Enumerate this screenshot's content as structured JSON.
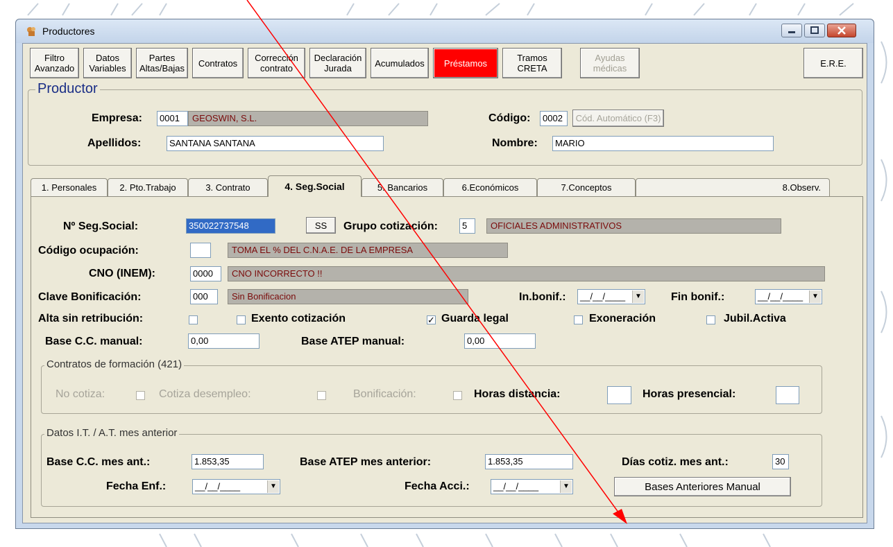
{
  "window": {
    "title": "Productores"
  },
  "toolbar": [
    {
      "label": "Filtro\nAvanzado"
    },
    {
      "label": "Datos\nVariables"
    },
    {
      "label": "Partes\nAltas/Bajas"
    },
    {
      "label": "Contratos"
    },
    {
      "label": "Corrección\ncontrato"
    },
    {
      "label": "Declaración\nJurada"
    },
    {
      "label": "Acumulados"
    },
    {
      "label": "Préstamos",
      "state": "highlighted",
      "color": "#ff0000"
    },
    {
      "label": "Tramos\nCRETA"
    },
    {
      "label": "Ayudas\nmédicas",
      "state": "disabled"
    },
    {
      "label": "E.R.E."
    }
  ],
  "productor": {
    "legend": "Productor",
    "empresa_label": "Empresa:",
    "empresa_code": "0001",
    "empresa_name": "GEOSWIN, S.L.",
    "codigo_label": "Código:",
    "codigo_value": "0002",
    "auto_button": "Cód. Automático (F3)",
    "apellidos_label": "Apellidos:",
    "apellidos_value": "SANTANA SANTANA",
    "nombre_label": "Nombre:",
    "nombre_value": "MARIO"
  },
  "tabs": [
    {
      "label": "1. Personales"
    },
    {
      "label": "2. Pto.Trabajo"
    },
    {
      "label": "3. Contrato"
    },
    {
      "label": "4. Seg.Social",
      "active": true
    },
    {
      "label": "5. Bancarios"
    },
    {
      "label": "6.Económicos"
    },
    {
      "label": "7.Conceptos"
    },
    {
      "label": "8.Observ."
    }
  ],
  "segsocial": {
    "nss_label": "Nº Seg.Social:",
    "nss_value": "350022737548",
    "ss_button": "SS",
    "grupo_label": "Grupo cotización:",
    "grupo_value": "5",
    "grupo_desc": "OFICIALES ADMINISTRATIVOS",
    "ocupacion_label": "Código ocupación:",
    "ocupacion_value": "",
    "ocupacion_desc": "TOMA EL % DEL C.N.A.E. DE LA EMPRESA",
    "cno_label": "CNO (INEM):",
    "cno_value": "0000",
    "cno_desc": "CNO INCORRECTO !!",
    "bonif_label": "Clave Bonificación:",
    "bonif_value": "000",
    "bonif_desc": "Sin Bonificacion",
    "inbonif_label": "In.bonif.:",
    "inbonif_value": "__/__/____",
    "finbonif_label": "Fin bonif.:",
    "finbonif_value": "__/__/____",
    "alta_sin_label": "Alta sin retribución:",
    "alta_sin_checked": false,
    "exento_label": "Exento cotización",
    "exento_checked": false,
    "guarda_label": "Guarda legal",
    "guarda_checked": true,
    "exoneracion_label": "Exoneración",
    "exoneracion_checked": false,
    "jubil_label": "Jubil.Activa",
    "jubil_checked": false,
    "basecc_label": "Base C.C. manual:",
    "basecc_value": "0,00",
    "baseatep_label": "Base ATEP manual:",
    "baseatep_value": "0,00"
  },
  "formacion": {
    "legend": "Contratos de formación (421)",
    "nocotiza_label": "No cotiza:",
    "desempleo_label": "Cotiza desempleo:",
    "bonificacion_label": "Bonificación:",
    "horas_dist_label": "Horas distancia:",
    "horas_dist_value": "",
    "horas_pres_label": "Horas presencial:",
    "horas_pres_value": ""
  },
  "it_at": {
    "legend": "Datos I.T. / A.T. mes anterior",
    "basecc_label": "Base C.C. mes ant.:",
    "basecc_value": "1.853,35",
    "baseatep_label": "Base ATEP mes anterior:",
    "baseatep_value": "1.853,35",
    "dias_label": "Días cotiz. mes ant.:",
    "dias_value": "30",
    "fechaenf_label": "Fecha Enf.:",
    "fechaenf_value": "__/__/____",
    "fechaacc_label": "Fecha Acci.:",
    "fechaacc_value": "__/__/____",
    "bases_button": "Bases Anteriores Manual"
  },
  "annotation": {
    "arrow_color": "#ff0000"
  }
}
